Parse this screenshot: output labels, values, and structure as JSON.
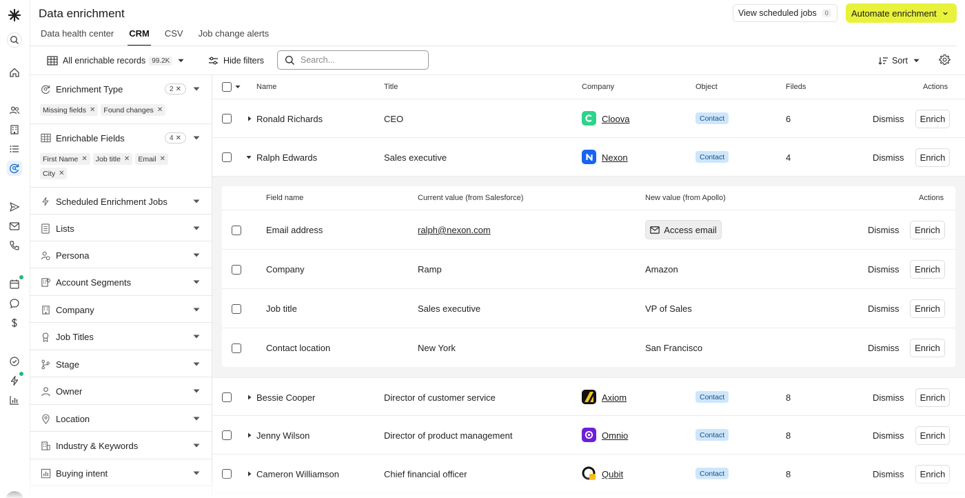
{
  "header": {
    "title": "Data enrichment",
    "tabs": [
      {
        "label": "Data health center"
      },
      {
        "label": "CRM"
      },
      {
        "label": "CSV"
      },
      {
        "label": "Job change alerts"
      }
    ],
    "active_tab": "CRM",
    "view_scheduled_label": "View scheduled jobs",
    "view_scheduled_count": "0",
    "automate_label": "Automate enrichment",
    "accent_color": "#e9f23b"
  },
  "toolbar": {
    "records_label": "All enrichable records",
    "records_count": "99.2K",
    "hide_filters_label": "Hide filters",
    "search_placeholder": "Search...",
    "sort_label": "Sort"
  },
  "filters": [
    {
      "label": "Enrichment Type",
      "icon": "enrichment-icon",
      "badge": "2",
      "chips": [
        "Missing fields",
        "Found changes"
      ]
    },
    {
      "label": "Enrichable Fields",
      "icon": "table-icon",
      "badge": "4",
      "chips": [
        "First Name",
        "Job title",
        "Email",
        "City"
      ]
    },
    {
      "label": "Scheduled Enrichment Jobs",
      "icon": "bolt-icon"
    },
    {
      "label": "Lists",
      "icon": "list-icon"
    },
    {
      "label": "Persona",
      "icon": "persona-icon"
    },
    {
      "label": "Account Segments",
      "icon": "segments-icon"
    },
    {
      "label": "Company",
      "icon": "building-icon"
    },
    {
      "label": "Job Titles",
      "icon": "badge-icon"
    },
    {
      "label": "Stage",
      "icon": "stage-icon"
    },
    {
      "label": "Owner",
      "icon": "user-icon"
    },
    {
      "label": "Location",
      "icon": "pin-icon"
    },
    {
      "label": "Industry & Keywords",
      "icon": "industry-icon"
    },
    {
      "label": "Buying intent",
      "icon": "chart-icon"
    }
  ],
  "table": {
    "columns": {
      "name": "Name",
      "title": "Title",
      "company": "Company",
      "object": "Object",
      "fields": "Fileds",
      "actions": "Actions"
    },
    "dismiss_label": "Dismiss",
    "enrich_label": "Enrich",
    "rows": [
      {
        "name": "Ronald Richards",
        "title": "CEO",
        "company": "Cloova",
        "object": "Contact",
        "fields": "6"
      },
      {
        "name": "Ralph Edwards",
        "title": "Sales executive",
        "company": "Nexon",
        "object": "Contact",
        "fields": "4"
      },
      {
        "name": "Bessie Cooper",
        "title": "Director of customer service",
        "company": "Axiom",
        "object": "Contact",
        "fields": "8"
      },
      {
        "name": "Jenny Wilson",
        "title": "Director of product management",
        "company": "Omnio",
        "object": "Contact",
        "fields": "8"
      },
      {
        "name": "Cameron Williamson",
        "title": "Chief financial officer",
        "company": "Qubit",
        "object": "Contact",
        "fields": "8"
      }
    ]
  },
  "detail": {
    "columns": {
      "field": "Field name",
      "current": "Current value (from Salesforce)",
      "new": "New value (from Apollo)",
      "actions": "Actions"
    },
    "access_email_label": "Access email",
    "rows": [
      {
        "field": "Email address",
        "current": "ralph@nexon.com",
        "new": ""
      },
      {
        "field": "Company",
        "current": "Ramp",
        "new": "Amazon"
      },
      {
        "field": "Job title",
        "current": "Sales executive",
        "new": "VP of Sales"
      },
      {
        "field": "Contact location",
        "current": "New York",
        "new": "San Francisco"
      }
    ]
  },
  "colors": {
    "object_pill_bg": "#cde6fb",
    "active_nav": "#1f6fc9",
    "notification_dot": "#2bb673"
  }
}
